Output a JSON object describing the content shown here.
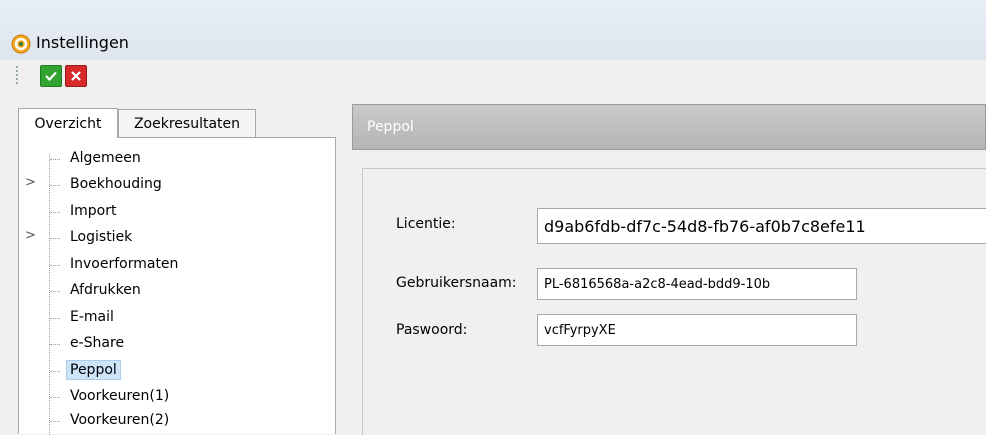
{
  "window": {
    "title": "Instellingen",
    "app_icon": "settings-gear-icon"
  },
  "toolbar": {
    "ok_icon": "checkmark-icon",
    "cancel_icon": "x-icon"
  },
  "tabs": [
    {
      "label": "Overzicht",
      "active": true
    },
    {
      "label": "Zoekresultaten",
      "active": false
    }
  ],
  "tree": {
    "items": [
      {
        "label": "Algemeen",
        "expandable": false
      },
      {
        "label": "Boekhouding",
        "expandable": true
      },
      {
        "label": "Import",
        "expandable": false
      },
      {
        "label": "Logistiek",
        "expandable": true
      },
      {
        "label": "Invoerformaten",
        "expandable": false
      },
      {
        "label": "Afdrukken",
        "expandable": false
      },
      {
        "label": "E-mail",
        "expandable": false
      },
      {
        "label": "e-Share",
        "expandable": false
      },
      {
        "label": "Peppol",
        "expandable": false,
        "selected": true
      },
      {
        "label": "Voorkeuren(1)",
        "expandable": false
      },
      {
        "label": "Voorkeuren(2)",
        "expandable": false
      }
    ]
  },
  "content": {
    "header": "Peppol",
    "fields": {
      "licentie": {
        "label": "Licentie:",
        "value": "d9ab6fdb-df7c-54d8-fb76-af0b7c8efe11"
      },
      "gebruikersnaam": {
        "label": "Gebruikersnaam:",
        "value": "PL-6816568a-a2c8-4ead-bdd9-10b"
      },
      "paswoord": {
        "label": "Paswoord:",
        "value": "vcfFyrpyXE"
      }
    }
  },
  "colors": {
    "ok_green": "#33a332",
    "cancel_red": "#d62b2b",
    "header_gray": "#bdbdbd",
    "selection_blue": "#cde3f7"
  }
}
